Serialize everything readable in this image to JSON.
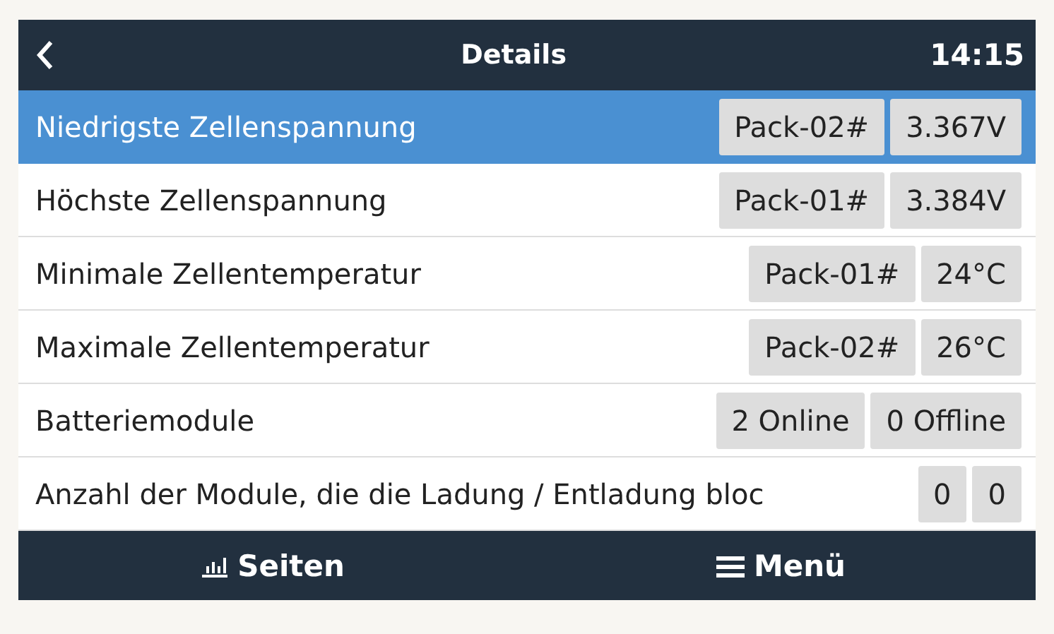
{
  "header": {
    "title": "Details",
    "time": "14:15"
  },
  "rows": [
    {
      "label": "Niedrigste Zellenspannung",
      "values": [
        "Pack-02#",
        "3.367V"
      ],
      "selected": true
    },
    {
      "label": "Höchste Zellenspannung",
      "values": [
        "Pack-01#",
        "3.384V"
      ],
      "selected": false
    },
    {
      "label": "Minimale Zellentemperatur",
      "values": [
        "Pack-01#",
        "24°C"
      ],
      "selected": false
    },
    {
      "label": "Maximale Zellentemperatur",
      "values": [
        "Pack-02#",
        "26°C"
      ],
      "selected": false
    },
    {
      "label": "Batteriemodule",
      "values": [
        "2 Online",
        "0 Offline"
      ],
      "selected": false
    },
    {
      "label": "Anzahl der Module, die die Ladung / Entladung bloc",
      "values": [
        "0",
        "0"
      ],
      "selected": false
    }
  ],
  "footer": {
    "left": "Seiten",
    "right": "Menü"
  }
}
